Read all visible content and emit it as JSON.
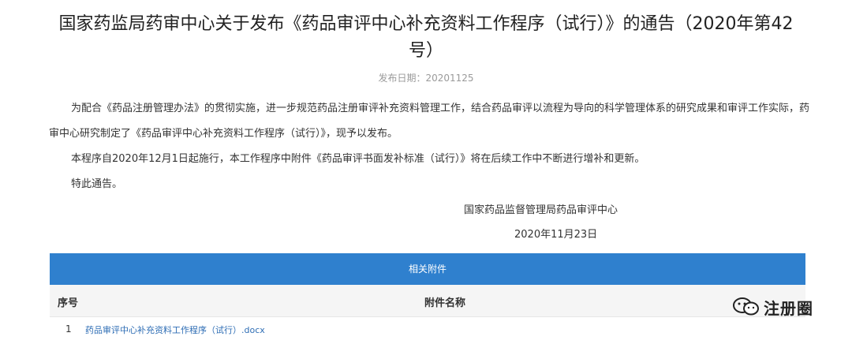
{
  "notice": {
    "title": "国家药监局药审中心关于发布《药品审评中心补充资料工作程序（试行）》的通告（2020年第42号）",
    "date_label": "发布日期：20201125",
    "paragraphs": [
      "为配合《药品注册管理办法》的贯彻实施，进一步规范药品注册审评补充资料管理工作，结合药品审评以流程为导向的科学管理体系的研究成果和审评工作实际，药审中心研究制定了《药品审评中心补充资料工作程序（试行）》，现予以发布。",
      "本程序自2020年12月1日起施行，本工作程序中附件《药品审评书面发补标准（试行）》将在后续工作中不断进行增补和更新。",
      "特此通告。"
    ],
    "signature_org": "国家药品监督管理局药品审评中心",
    "signature_date": "2020年11月23日"
  },
  "attachments": {
    "header": "相关附件",
    "columns": [
      "序号",
      "附件名称"
    ],
    "rows": [
      {
        "seq": "1",
        "name": "药品审评中心补充资料工作程序（试行）.docx"
      }
    ]
  },
  "watermark": {
    "text": "注册圈",
    "icon": "wechat-icon"
  },
  "colors": {
    "accent": "#2f80ce",
    "link": "#2f6eb5",
    "muted": "#9a9a9a"
  }
}
